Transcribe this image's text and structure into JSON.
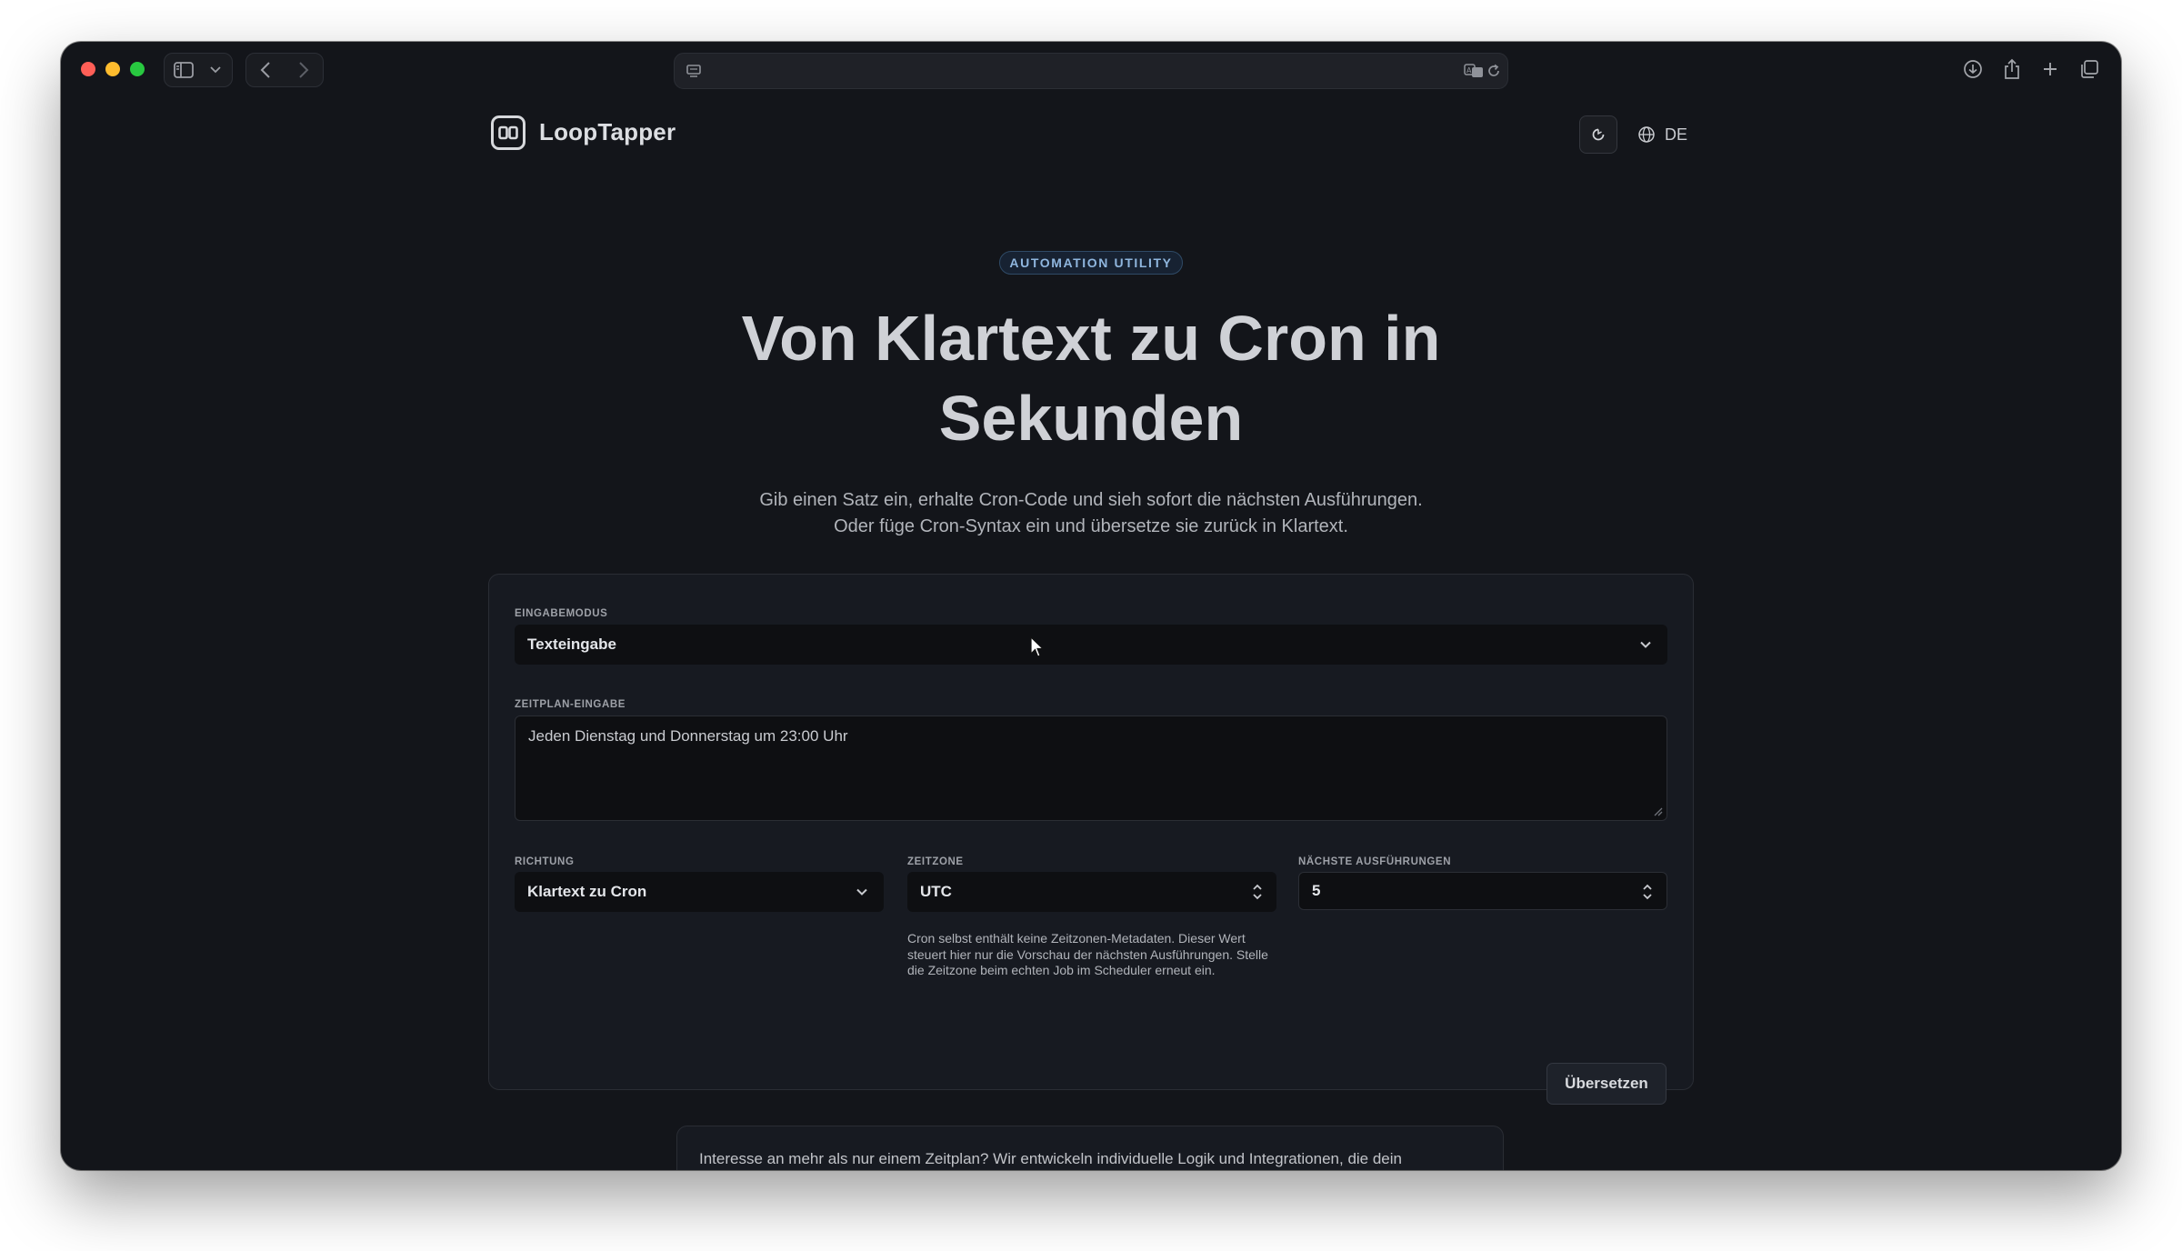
{
  "header": {
    "brand": "LoopTapper",
    "language": "DE"
  },
  "hero": {
    "badge": "AUTOMATION UTILITY",
    "title": "Von Klartext zu Cron in Sekunden",
    "subtitle_line1": "Gib einen Satz ein, erhalte Cron-Code und sieh sofort die nächsten Ausführungen.",
    "subtitle_line2": "Oder füge Cron-Syntax ein und übersetze sie zurück in Klartext."
  },
  "form": {
    "mode_label": "EINGABEMODUS",
    "mode_value": "Texteingabe",
    "schedule_label": "ZEITPLAN-EINGABE",
    "schedule_value": "Jeden Dienstag und Donnerstag um 23:00 Uhr",
    "direction_label": "RICHTUNG",
    "direction_value": "Klartext zu Cron",
    "timezone_label": "ZEITZONE",
    "timezone_value": "UTC",
    "runs_label": "NÄCHSTE AUSFÜHRUNGEN",
    "runs_value": "5",
    "timezone_help": "Cron selbst enthält keine Zeitzonen-Metadaten. Dieser Wert steuert hier nur die Vorschau der nächsten Ausführungen. Stelle die Zeitzone beim echten Job im Scheduler erneut ein.",
    "submit_label": "Übersetzen"
  },
  "promo": {
    "text": "Interesse an mehr als nur einem Zeitplan? Wir entwickeln individuelle Logik und Integrationen, die dein"
  },
  "icons": {
    "sidebar": "sidebar-icon",
    "back": "chevron-left-icon",
    "forward": "chevron-right-icon",
    "reader": "reader-icon",
    "translate": "translate-icon",
    "reload": "reload-icon",
    "download": "download-icon",
    "share": "share-icon",
    "new_tab": "plus-icon",
    "tabs": "tabs-icon",
    "theme": "theme-toggle-icon",
    "globe": "globe-icon"
  }
}
